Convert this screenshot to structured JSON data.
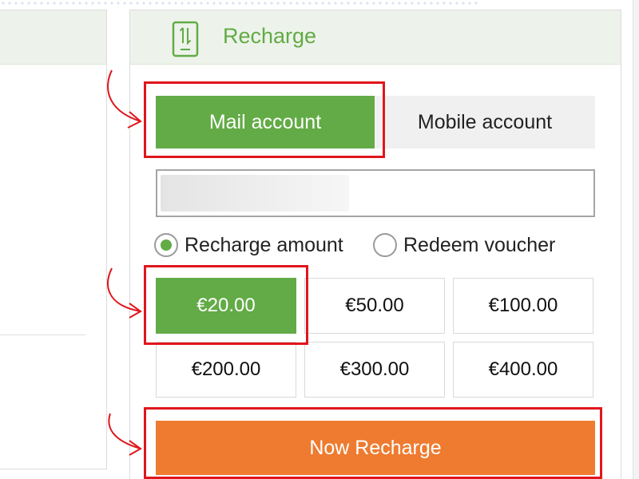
{
  "panel": {
    "title": "Recharge",
    "icon": "phone-icon"
  },
  "tabs": [
    {
      "label": "Mail account",
      "active": true
    },
    {
      "label": "Mobile account",
      "active": false
    }
  ],
  "account_input": {
    "value": ""
  },
  "options": [
    {
      "label": "Recharge amount",
      "selected": true
    },
    {
      "label": "Redeem voucher",
      "selected": false
    }
  ],
  "amounts": [
    "€20.00",
    "€50.00",
    "€100.00",
    "€200.00",
    "€300.00",
    "€400.00"
  ],
  "selected_amount": "€20.00",
  "action_button": "Now Recharge",
  "colors": {
    "green": "#62ab46",
    "orange": "#ee7b30",
    "highlight": "#e0161c"
  }
}
